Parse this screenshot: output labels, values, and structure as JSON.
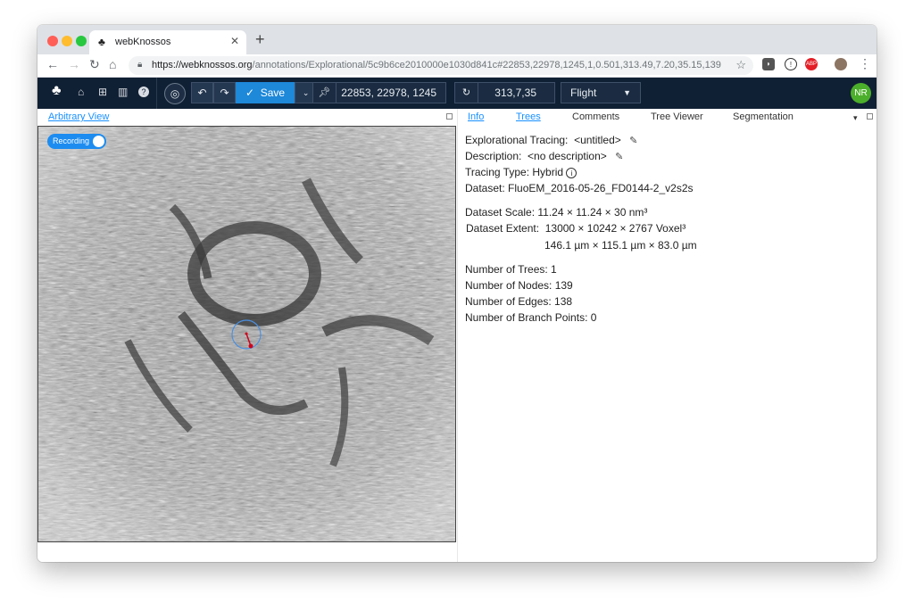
{
  "browser": {
    "tab_title": "webKnossos",
    "url_domain": "https://webknossos.org",
    "url_path": "/annotations/Explorational/5c9b6ce2010000e1030d841c#22853,22978,1245,1,0.501,313.49,7.20,35.15,139",
    "ext_abp": "ABP"
  },
  "toolbar": {
    "save_label": "Save",
    "position": "22853, 22978, 1245",
    "rotation": "313,7,35",
    "mode": "Flight",
    "avatar_initials": "NR"
  },
  "left_pane": {
    "tab_label": "Arbitrary View",
    "recording_label": "Recording"
  },
  "right_pane": {
    "tabs": [
      "Info",
      "Trees",
      "Comments",
      "Tree Viewer",
      "Segmentation"
    ],
    "info": {
      "tracing_label": "Explorational Tracing:",
      "tracing_name": "<untitled>",
      "description_label": "Description:",
      "description_value": "<no description>",
      "type_label": "Tracing Type:",
      "type_value": "Hybrid",
      "dataset_label": "Dataset:",
      "dataset_value": "FluoEM_2016-05-26_FD0144-2_v2s2s",
      "scale_label": "Dataset Scale:",
      "scale_value": "11.24 × 11.24 × 30 nm³",
      "extent_label": "Dataset Extent:",
      "extent_voxel": "13000 × 10242 × 2767 Voxel³",
      "extent_um": "146.1 µm × 115.1 µm × 83.0 µm",
      "trees": "Number of Trees: 1",
      "nodes": "Number of Nodes: 139",
      "edges": "Number of Edges: 138",
      "branch_points": "Number of Branch Points: 0"
    }
  }
}
